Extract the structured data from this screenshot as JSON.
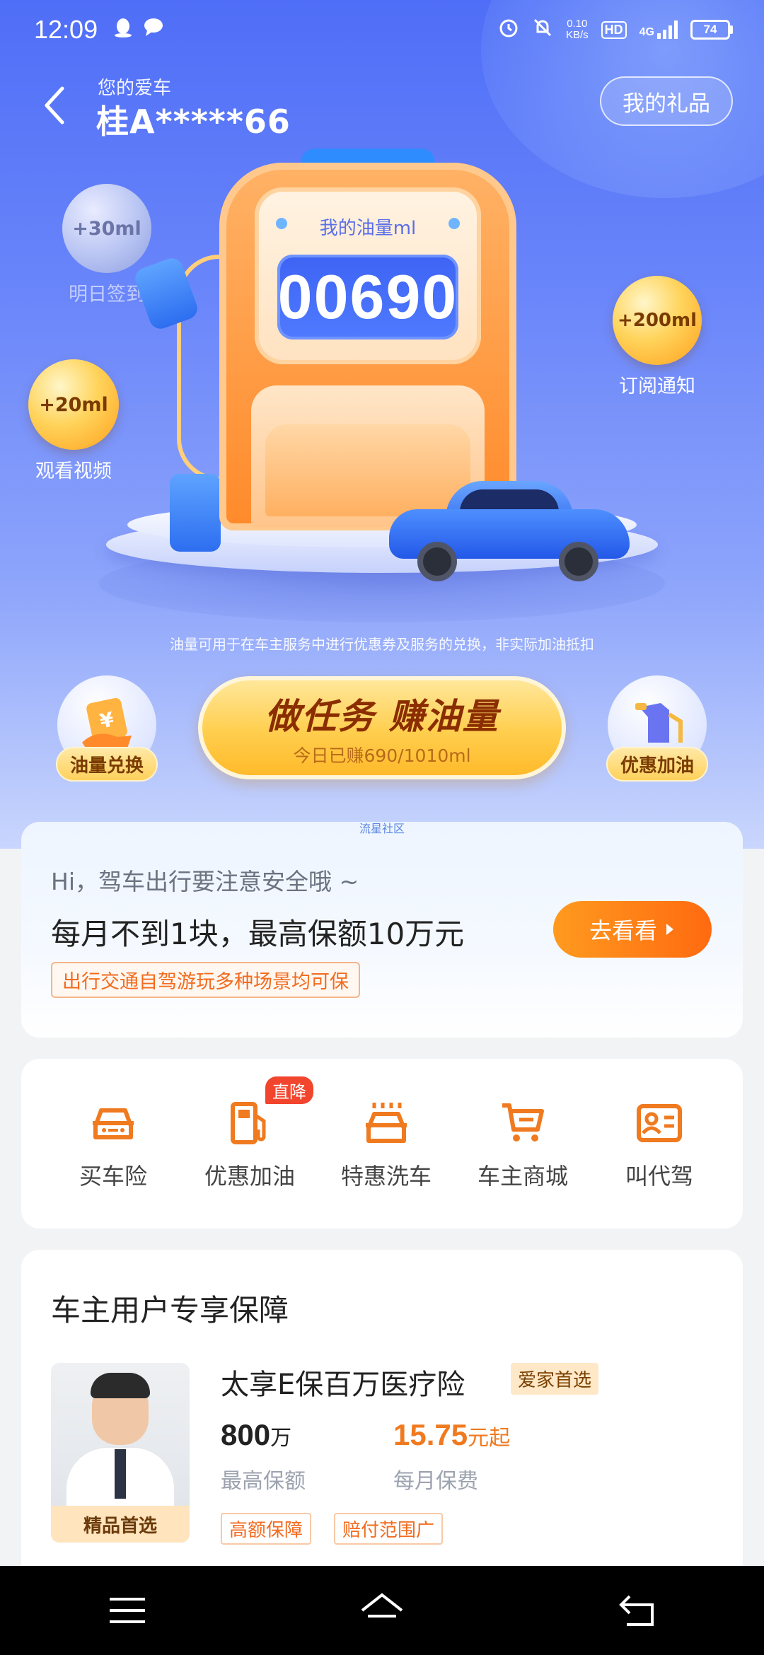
{
  "status_bar": {
    "time": "12:09",
    "net_speed_value": "0.10",
    "net_speed_unit": "KB/s",
    "hd_label": "HD",
    "network": "4G",
    "battery": "74"
  },
  "header": {
    "subtitle": "您的爱车",
    "plate": "桂A*****66",
    "gift_button": "我的礼品"
  },
  "bubbles": {
    "checkin": {
      "reward": "+30ml",
      "label": "明日签到"
    },
    "video": {
      "reward": "+20ml",
      "label": "观看视频"
    },
    "subscribe": {
      "reward": "+200ml",
      "label": "订阅通知"
    }
  },
  "pump": {
    "label": "我的油量ml",
    "value": "00690"
  },
  "disclaimer": "油量可用于在车主服务中进行优惠券及服务的兑换，非实际加油抵扣",
  "actions": {
    "exchange_label": "油量兑换",
    "task_title": "做任务 赚油量",
    "task_progress": "今日已赚690/1010ml",
    "refuel_label": "优惠加油"
  },
  "community_tag": "流星社区",
  "promo": {
    "greeting": "Hi，驾车出行要注意安全哦 ~",
    "headline": "每月不到1块，最高保额10万元",
    "tag": "出行交通自驾游玩多种场景均可保",
    "button": "去看看"
  },
  "services": [
    {
      "label": "买车险",
      "icon": "car-insurance-icon"
    },
    {
      "label": "优惠加油",
      "icon": "fuel-pump-icon",
      "badge": "直降"
    },
    {
      "label": "特惠洗车",
      "icon": "car-wash-icon"
    },
    {
      "label": "车主商城",
      "icon": "shopping-cart-icon"
    },
    {
      "label": "叫代驾",
      "icon": "driver-card-icon"
    }
  ],
  "protection": {
    "title": "车主用户专享保障",
    "photo_caption": "精品首选",
    "product_name": "太享E保百万医疗险",
    "product_badge": "爱家首选",
    "coverage_value": "800",
    "coverage_unit": "万",
    "coverage_label": "最高保额",
    "premium_value": "15.75",
    "premium_unit": "元起",
    "premium_label": "每月保费",
    "features": [
      "高额保障",
      "赔付范围广"
    ]
  },
  "colors": {
    "hero_blue": "#4f6ef7",
    "accent_orange": "#ff6a10",
    "gold": "#ffce4d",
    "badge_red": "#f2452e"
  }
}
